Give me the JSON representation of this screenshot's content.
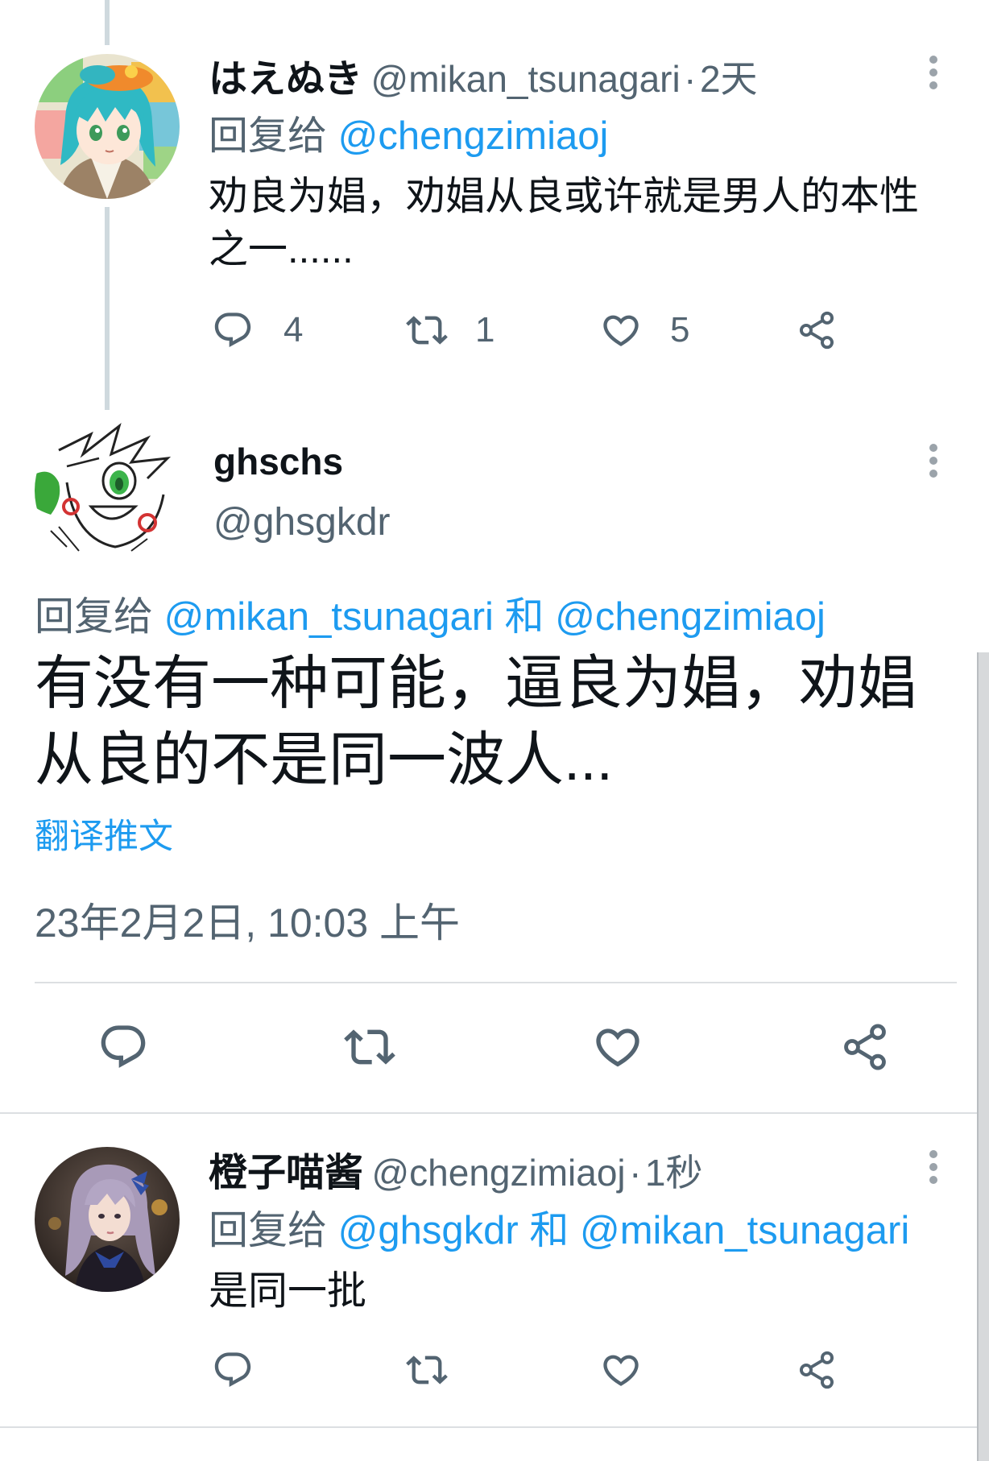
{
  "colors": {
    "text": "#0f1419",
    "secondary": "#536471",
    "link": "#1d9bf0",
    "divider": "#dcdfe2",
    "thread_line": "#cfd9de",
    "icon": "#536471",
    "menu_dots": "#9ba3aa",
    "scrollbar": "#d7d9db"
  },
  "icons": {
    "reply": "reply-icon",
    "retweet": "retweet-icon",
    "like": "heart-icon",
    "share": "share-icon",
    "more": "more-vertical-icon"
  },
  "thread": {
    "parent": {
      "display_name": "はえぬき",
      "handle": "@mikan_tsunagari",
      "separator": "·",
      "time": "2天",
      "reply_to_label": "回复给",
      "reply_to_1": "@chengzimiaoj",
      "text_lines": [
        "劝良为娼，劝娼从良或许就是男人的本性",
        "之一......"
      ],
      "reply_count": "4",
      "retweet_count": "1",
      "like_count": "5"
    },
    "focused": {
      "display_name": "ghschs",
      "handle": "@ghsgkdr",
      "reply_to_label": "回复给",
      "reply_to_1": "@mikan_tsunagari",
      "conjunction": "和",
      "reply_to_2": "@chengzimiaoj",
      "text_lines": [
        "有没有一种可能，逼良为娼，劝娼",
        "从良的不是同一波人..."
      ],
      "translate_link": "翻译推文",
      "timestamp": "23年2月2日, 10:03 上午"
    },
    "reply": {
      "display_name": "橙子喵酱",
      "handle": "@chengzimiaoj",
      "separator": "·",
      "time": "1秒",
      "reply_to_label": "回复给",
      "reply_to_1": "@ghsgkdr",
      "conjunction": "和",
      "reply_to_2": "@mikan_tsunagari",
      "text_lines": [
        "是同一批"
      ]
    }
  }
}
